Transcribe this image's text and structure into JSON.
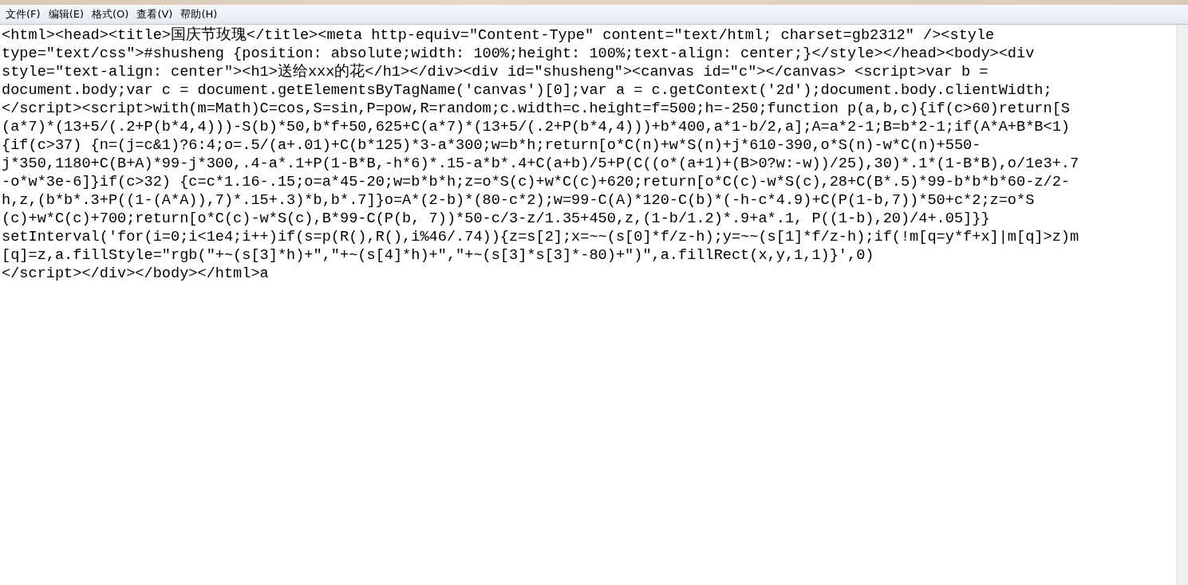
{
  "menu": [
    {
      "label": "文件(F)"
    },
    {
      "label": "编辑(E)"
    },
    {
      "label": "格式(O)"
    },
    {
      "label": "查看(V)"
    },
    {
      "label": "帮助(H)"
    }
  ],
  "editor": {
    "lines": [
      "<html><head><title>国庆节玫瑰</title><meta http-equiv=\"Content-Type\" content=\"text/html; charset=gb2312\" /><style",
      "type=\"text/css\">#shusheng {position: absolute;width: 100%;height: 100%;text-align: center;}</style></head><body><div",
      "style=\"text-align: center\"><h1>送给xxx的花</h1></div><div id=\"shusheng\"><canvas id=\"c\"></canvas> <script>var b =",
      "document.body;var c = document.getElementsByTagName('canvas')[0];var a = c.getContext('2d');document.body.clientWidth;",
      "</script><script>with(m=Math)C=cos,S=sin,P=pow,R=random;c.width=c.height=f=500;h=-250;function p(a,b,c){if(c>60)return[S",
      "(a*7)*(13+5/(.2+P(b*4,4)))-S(b)*50,b*f+50,625+C(a*7)*(13+5/(.2+P(b*4,4)))+b*400,a*1-b/2,a];A=a*2-1;B=b*2-1;if(A*A+B*B<1)",
      "{if(c>37) {n=(j=c&1)?6:4;o=.5/(a+.01)+C(b*125)*3-a*300;w=b*h;return[o*C(n)+w*S(n)+j*610-390,o*S(n)-w*C(n)+550-",
      "j*350,1180+C(B+A)*99-j*300,.4-a*.1+P(1-B*B,-h*6)*.15-a*b*.4+C(a+b)/5+P(C((o*(a+1)+(B>0?w:-w))/25),30)*.1*(1-B*B),o/1e3+.7",
      "-o*w*3e-6]}if(c>32) {c=c*1.16-.15;o=a*45-20;w=b*b*h;z=o*S(c)+w*C(c)+620;return[o*C(c)-w*S(c),28+C(B*.5)*99-b*b*b*60-z/2-",
      "h,z,(b*b*.3+P((1-(A*A)),7)*.15+.3)*b,b*.7]}o=A*(2-b)*(80-c*2);w=99-C(A)*120-C(b)*(-h-c*4.9)+C(P(1-b,7))*50+c*2;z=o*S",
      "(c)+w*C(c)+700;return[o*C(c)-w*S(c),B*99-C(P(b, 7))*50-c/3-z/1.35+450,z,(1-b/1.2)*.9+a*.1, P((1-b),20)/4+.05]}}",
      "setInterval('for(i=0;i<1e4;i++)if(s=p(R(),R(),i%46/.74)){z=s[2];x=~~(s[0]*f/z-h);y=~~(s[1]*f/z-h);if(!m[q=y*f+x]|m[q]>z)m",
      "[q]=z,a.fillStyle=\"rgb(\"+~(s[3]*h)+\",\"+~(s[4]*h)+\",\"+~(s[3]*s[3]*-80)+\")\",a.fillRect(x,y,1,1)}',0)",
      "</script></div></body></html>a"
    ]
  }
}
